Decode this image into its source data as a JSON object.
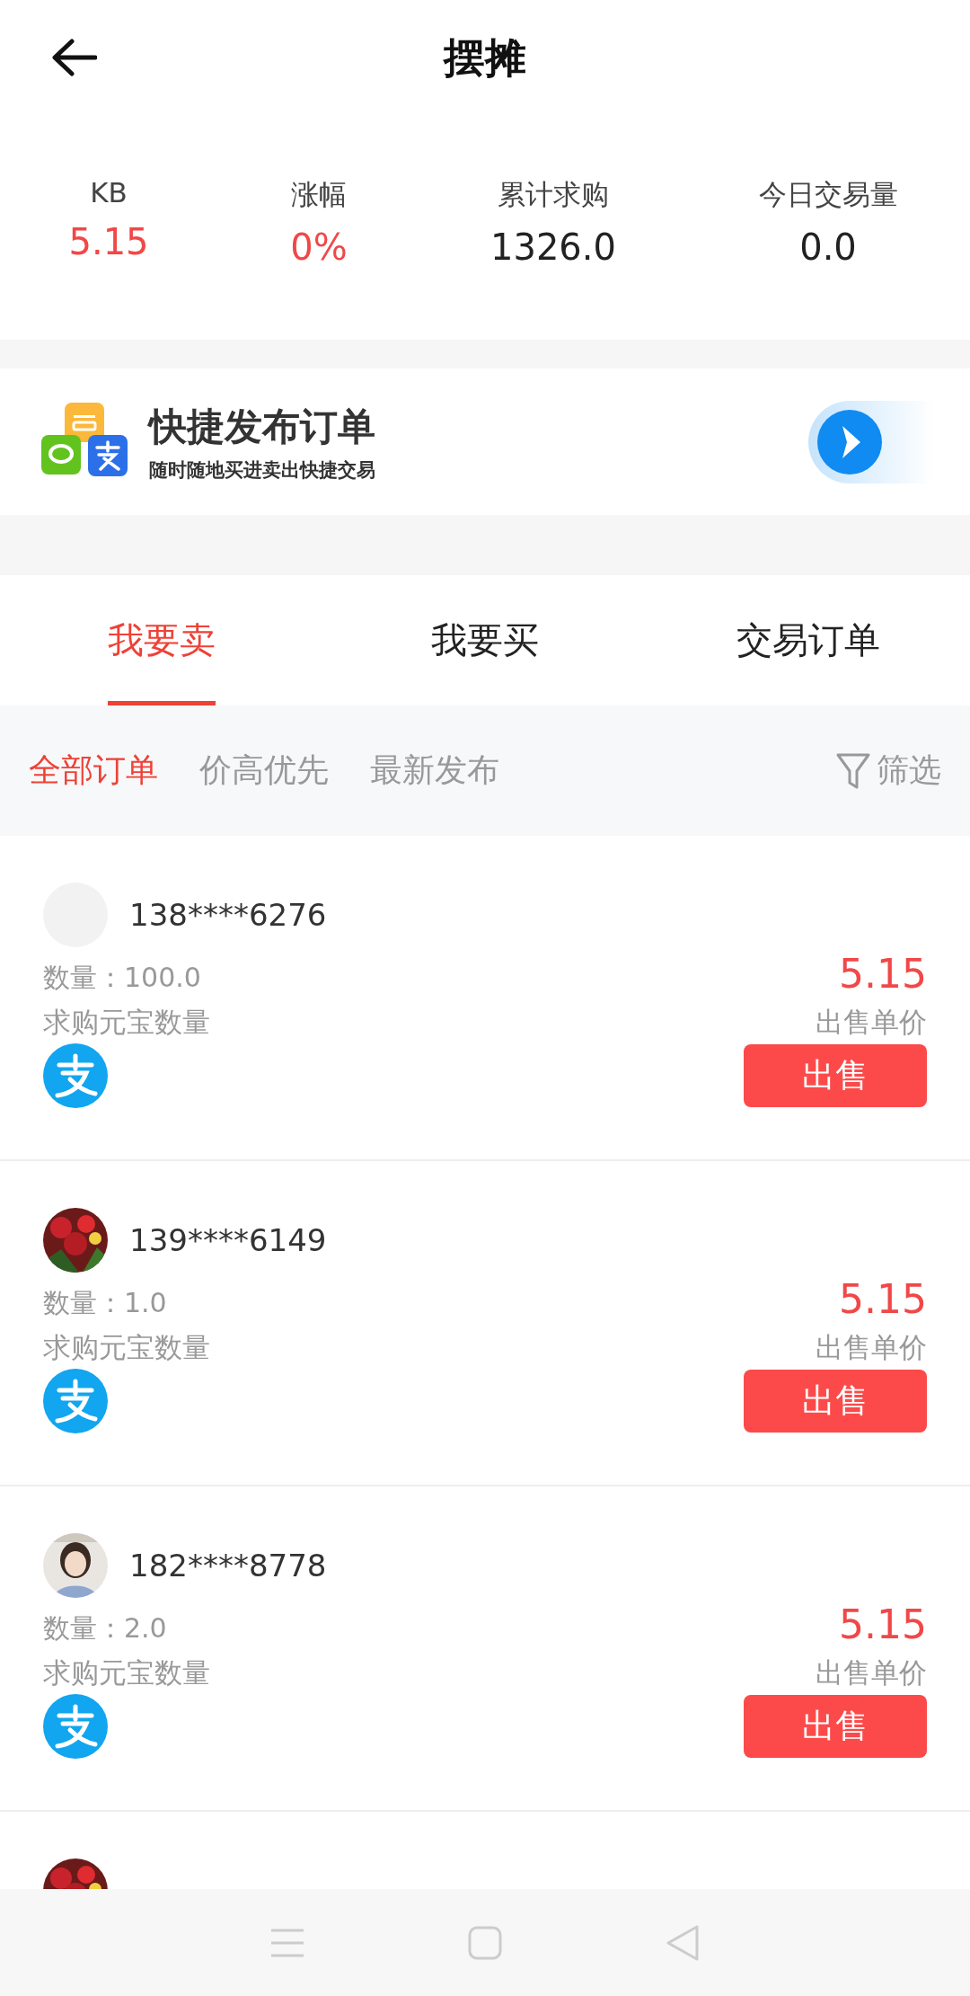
{
  "header": {
    "title": "摆摊"
  },
  "stats": [
    {
      "label": "KB",
      "value": "5.15",
      "highlight": true
    },
    {
      "label": "涨幅",
      "value": "0%",
      "highlight": true
    },
    {
      "label": "累计求购",
      "value": "1326.0",
      "highlight": false
    },
    {
      "label": "今日交易量",
      "value": "0.0",
      "highlight": false
    }
  ],
  "banner": {
    "title": "快捷发布订单",
    "subtitle": "随时随地买进卖出快捷交易"
  },
  "tabs": [
    {
      "label": "我要卖",
      "selected": true
    },
    {
      "label": "我要买",
      "selected": false
    },
    {
      "label": "交易订单",
      "selected": false
    }
  ],
  "filters": {
    "sorts": [
      {
        "label": "全部订单",
        "selected": true
      },
      {
        "label": "价高优先",
        "selected": false
      },
      {
        "label": "最新发布",
        "selected": false
      }
    ],
    "filter_label": "筛选"
  },
  "orders": [
    {
      "avatar": {
        "kind": "blank"
      },
      "user": "138****6276",
      "quantity_label": "数量：",
      "quantity": "100.0",
      "quantity_caption": "求购元宝数量",
      "price": "5.15",
      "price_caption": "出售单价",
      "action": "出售"
    },
    {
      "avatar": {
        "kind": "picture"
      },
      "user": "139****6149",
      "quantity_label": "数量：",
      "quantity": "1.0",
      "quantity_caption": "求购元宝数量",
      "price": "5.15",
      "price_caption": "出售单价",
      "action": "出售"
    },
    {
      "avatar": {
        "kind": "picture"
      },
      "user": "182****8778",
      "quantity_label": "数量：",
      "quantity": "2.0",
      "quantity_caption": "求购元宝数量",
      "price": "5.15",
      "price_caption": "出售单价",
      "action": "出售"
    },
    {
      "avatar": {
        "kind": "picture"
      }
    }
  ]
}
